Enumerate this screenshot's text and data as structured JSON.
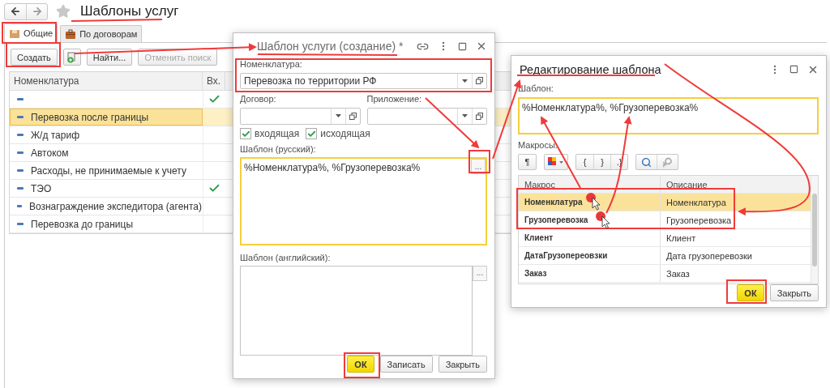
{
  "main_window": {
    "title": "Шаблоны услуг",
    "tabs": [
      {
        "label": "Общие",
        "selected": true
      },
      {
        "label": "По договорам",
        "selected": false
      }
    ],
    "toolbar": [
      {
        "kind": "text",
        "label": "Создать",
        "disabled": false
      },
      {
        "kind": "add-copy",
        "disabled": false
      },
      {
        "kind": "text",
        "label": "Найти...",
        "disabled": false
      },
      {
        "kind": "text",
        "label": "Отменить поиск",
        "disabled": true
      }
    ],
    "table": {
      "columns": [
        "Номенклатура",
        "Вх."
      ],
      "rows": [
        {
          "incoming": true,
          "selected": false
        },
        {
          "name": "Перевозка после границы",
          "incoming": false,
          "selected": true
        },
        {
          "name": "Ж/д тариф",
          "incoming": false,
          "selected": false
        },
        {
          "name": "Автоком",
          "incoming": false,
          "selected": false
        },
        {
          "name": "Расходы, не принимаемые к учету",
          "incoming": false,
          "selected": false
        },
        {
          "name": "ТЭО",
          "incoming": true,
          "selected": false
        },
        {
          "name": "Вознаграждение экспедитора (агента)",
          "incoming": false,
          "selected": false
        },
        {
          "name": "Перевозка до границы",
          "incoming": false,
          "selected": false
        }
      ]
    }
  },
  "service_template_dialog": {
    "title": "Шаблон услуги (создание)",
    "modified_mark": "*",
    "nomenclature": {
      "label": "Номенклатура:",
      "value": "Перевозка по территории РФ"
    },
    "contract": {
      "label": "Договор:"
    },
    "appendix": {
      "label": "Приложение:"
    },
    "checkboxes": [
      {
        "label": "входящая",
        "checked": true
      },
      {
        "label": "исходящая",
        "checked": true
      }
    ],
    "template_ru": {
      "label": "Шаблон (русский):",
      "value": "%Номенклатура%, %Грузоперевозка%",
      "focused": true,
      "select_button": "..."
    },
    "template_en": {
      "label": "Шаблон (английский):",
      "focused": false,
      "select_button": "..."
    },
    "buttons": [
      {
        "label": "ОК",
        "default": true
      },
      {
        "label": "Записать",
        "default": false
      },
      {
        "label": "Закрыть",
        "default": false
      }
    ]
  },
  "edit_template_dialog": {
    "title": "Редактирование шаблона",
    "template": {
      "label": "Шаблон:",
      "value": "%Номенклатура%, %Грузоперевозка%",
      "focused": true
    },
    "macros_label": "Макросы:",
    "toolbar_groups": [
      {
        "buttons": [
          {
            "kind": "text",
            "label": "¶",
            "disabled": false
          }
        ]
      },
      {
        "buttons": [
          {
            "kind": "palette"
          }
        ]
      },
      {
        "buttons": [
          {
            "kind": "text",
            "label": "{",
            "disabled": false
          },
          {
            "kind": "text",
            "label": "}",
            "disabled": false
          },
          {
            "kind": "text",
            "label": ".}",
            "disabled": false
          }
        ]
      },
      {
        "buttons": [
          {
            "kind": "search",
            "disabled": false
          },
          {
            "kind": "search-clear",
            "disabled": true
          }
        ]
      }
    ],
    "table": {
      "columns": [
        "Макрос",
        "Описание"
      ],
      "rows": [
        {
          "macro": "Номенклатура",
          "description": "Номенклатура",
          "selected": true
        },
        {
          "macro": "Грузоперевозка",
          "description": "Грузоперевозка",
          "selected": false
        },
        {
          "macro": "Клиент",
          "description": "Клиент",
          "selected": false
        },
        {
          "macro": "ДатаГрузопереовзки",
          "description": "Дата грузоперевозки",
          "selected": false
        },
        {
          "macro": "Заказ",
          "description": "Заказ",
          "selected": false
        }
      ]
    },
    "buttons": [
      {
        "label": "ОК",
        "default": true
      },
      {
        "label": "Закрыть",
        "default": false
      }
    ]
  }
}
